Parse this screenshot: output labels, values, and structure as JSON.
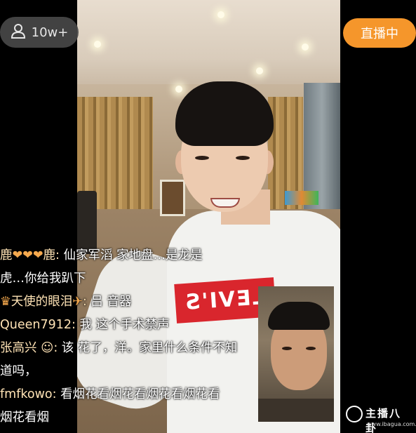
{
  "stream": {
    "viewer_count": "10w+",
    "live_label": "直播中",
    "viewer_icon": "user-icon"
  },
  "chat": {
    "messages": [
      {
        "user": "鹿",
        "badge": "❤❤❤",
        "user_end": "鹿",
        "text": "仙家军滔 家地盘…是龙是"
      },
      {
        "user": "",
        "badge": "",
        "user_end": "",
        "text": "虎…你给我趴下"
      },
      {
        "user": "天使的眼泪",
        "badge": "",
        "user_end": "",
        "text": ""
      },
      {
        "user": "Queen7912",
        "badge": "",
        "user_end": "",
        "text": "我 这个手术禁声"
      },
      {
        "user": "张高兴",
        "badge": "",
        "user_end": "",
        "text": "该 花了，洋。家里什么条件不知"
      },
      {
        "user": "",
        "badge": "",
        "user_end": "",
        "text": "道吗，"
      },
      {
        "user": "fmfkowo",
        "badge": "",
        "user_end": "",
        "text": "看烟花看烟花看烟花看烟花看"
      },
      {
        "user": "",
        "badge": "",
        "user_end": "",
        "text": "烟花看烟"
      }
    ],
    "partial": {
      "angel_tail": "吕 音器",
      "crown_icon": "crown-icon",
      "smile_icon": "smile-icon"
    }
  },
  "watermark": {
    "brand": "主播八卦",
    "url": "www.ibagua.com.cn"
  },
  "colors": {
    "live_orange": "#f5962b",
    "username_tan": "#ffe3b5",
    "heart_orange": "#f5a94e"
  }
}
